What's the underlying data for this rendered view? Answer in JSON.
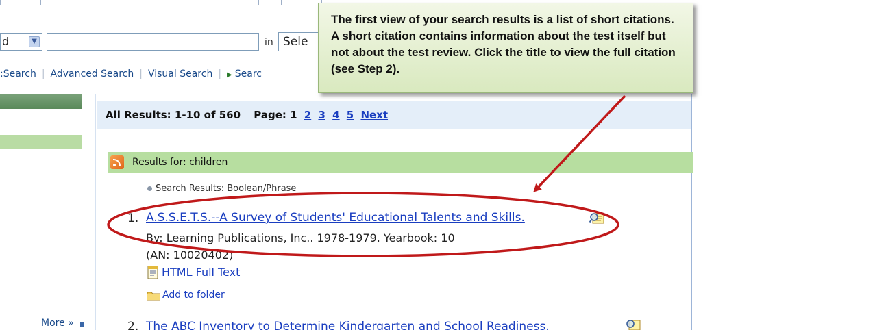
{
  "search": {
    "field_value": "d",
    "in_label": "in",
    "scope_value": "Sele"
  },
  "links": {
    "basic": ":Search",
    "advanced": "Advanced Search",
    "visual": "Visual Search",
    "more": "Searc"
  },
  "results": {
    "header_text": "All Results: 1-10 of 560",
    "page_label": "Page: 1",
    "pages": [
      "2",
      "3",
      "4",
      "5"
    ],
    "next_label": "Next",
    "results_for": "Results for: children",
    "search_results_label": "Search Results: Boolean/Phrase",
    "items": [
      {
        "number": "1.",
        "title": "A.S.S.E.T.S.--A Survey of Students' Educational Talents and Skills.",
        "byline": "By: Learning Publications, Inc.. 1978-1979. Yearbook: 10",
        "an": "(AN: 10020402)",
        "full_text_label": "HTML Full Text",
        "add_folder_label": "Add to folder"
      },
      {
        "number": "2.",
        "title": "The ABC Inventory to Determine Kindergarten and School Readiness."
      }
    ]
  },
  "sidebar": {
    "more_label": "More »"
  },
  "callout": {
    "text": "The first view of your search results is a list of short citations.  A short citation contains information about the test itself but not about the test review.  Click the title to view the full citation (see Step 2)."
  },
  "colors": {
    "annotation_red": "#c0191a",
    "callout_green": "#d9e9bf",
    "results_green": "#b7dea0",
    "link_blue": "#1a3ec0"
  },
  "icons": [
    "dropdown-arrow-icon",
    "rss-icon",
    "magnifier-preview-icon",
    "html-full-text-icon",
    "folder-icon"
  ]
}
